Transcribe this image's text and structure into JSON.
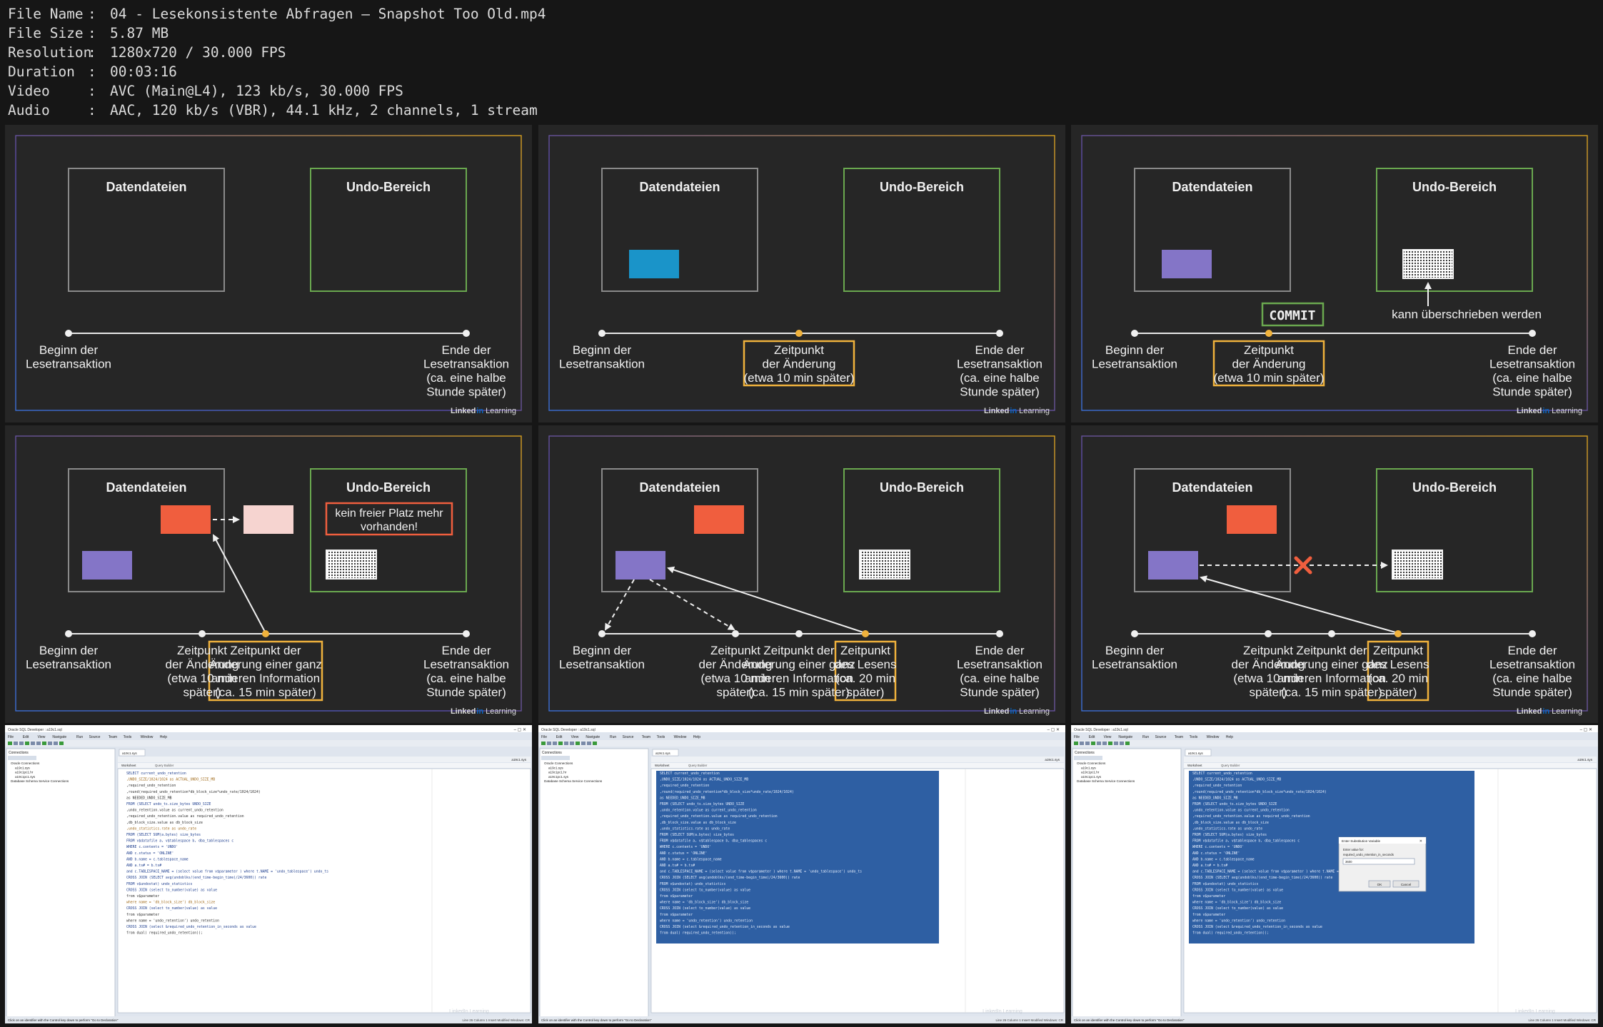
{
  "header": {
    "rows": [
      {
        "key": "File Name",
        "value": "04 - Lesekonsistente Abfragen – Snapshot Too Old.mp4"
      },
      {
        "key": "File Size",
        "value": "5.87 MB"
      },
      {
        "key": "Resolution",
        "value": "1280x720 / 30.000 FPS"
      },
      {
        "key": "Duration",
        "value": "00:03:16"
      },
      {
        "key": "Video",
        "value": "AVC (Main@L4), 123 kb/s, 30.000 FPS"
      },
      {
        "key": "Audio",
        "value": "AAC, 120 kb/s (VBR), 44.1 kHz, 2 channels, 1 stream"
      }
    ],
    "separator": ":"
  },
  "slides": {
    "datendateien": "Datendateien",
    "undo": "Undo-Bereich",
    "beginn": [
      "Beginn der",
      "Lesetransaktion"
    ],
    "ende": [
      "Ende der",
      "Lesetransaktion",
      "(ca. eine halbe",
      "Stunde später)"
    ],
    "aenderung": [
      "Zeitpunkt",
      "der Änderung",
      "(etwa 10 min später)"
    ],
    "aenderung_narrow": [
      "Zeitpunkt",
      "der Änderung",
      "(etwa 10 min",
      "später)"
    ],
    "andere": [
      "Zeitpunkt der",
      "Änderung einer ganz",
      "anderen Information",
      "(ca. 15 min später)"
    ],
    "lesen": [
      "Zeitpunkt",
      "des Lesens",
      "(ca. 20 min",
      "später)"
    ],
    "commit": "COMMIT",
    "ueberschrieben": "kann überschrieben werden",
    "kein_platz": [
      "kein freier Platz mehr",
      "vorhanden!"
    ],
    "brand_a": "Linked",
    "brand_in": "in",
    "brand_b": "Learning"
  },
  "ide": {
    "title": "Oracle SQL Developer : a19c1.sql",
    "menu": [
      "File",
      "Edit",
      "View",
      "Navigate",
      "Run",
      "Source",
      "Team",
      "Tools",
      "Window",
      "Help"
    ],
    "connections_label": "Connections",
    "tree": [
      "Oracle Connections",
      "a19c1.sys",
      "a19c1pc1.hr",
      "a19c1pc1.sys",
      "Database Schema Service Connections"
    ],
    "tab": "a19c1.sys",
    "subtabs": [
      "Worksheet",
      "Query Builder"
    ],
    "conn_label": "a19c1.sys",
    "code": [
      "SELECT current_undo_retention",
      "    ,UNDO_SIZE/1024/1024 as ACTUAL_UNDO_SIZE_MB",
      "    ,required_undo_retention",
      "    ,round(required_undo_retention*db_block_size*undo_rate/1024/1024)",
      "        as NEEDED_UNDO_SIZE_MB",
      "FROM (SELECT undo_ts.size_bytes UNDO_SIZE",
      "        ,undo_retention.value as current_undo_retention",
      "        ,required_undo_retention.value as required_undo_retention",
      "        ,db_block_size.value as db_block_size",
      "        ,undo_statistics.rate as undo_rate",
      "    FROM (SELECT SUM(a.bytes) size_bytes",
      "            FROM v$datafile a, v$tablespace b, dba_tablespaces c",
      "            WHERE c.contents = 'UNDO'",
      "            AND c.status = 'ONLINE'",
      "            AND b.name = c.tablespace_name",
      "            AND a.ts# = b.ts#",
      "            and c.TABLESPACE_NAME = (select value from v$parameter ) where t.NAME = 'undo_tablespace') undo_ts",
      "    CROSS JOIN (SELECT avg(undoblks/(end_time-begin_time)/24/3600)) rate",
      "                FROM v$undostat) undo_statistics",
      "    CROSS JOIN (select to_number(value) as value",
      "                from v$parameter",
      "                where name = 'db_block_size') db_block_size",
      "    CROSS JOIN (select to_number(value) as value",
      "                from v$parameter",
      "                where name = 'undo_retention') undo_retention",
      "    CROSS JOIN (select &required_undo_retention_in_seconds as value",
      "                from dual) required_undo_retention));"
    ],
    "status_text": "Click on an identifier with the Control key down to perform \"Go to Declaration\"",
    "status_right": [
      "Line 26 Column 1",
      "Insert",
      "Modified",
      "Windows: CR"
    ],
    "dialog": {
      "title": "Enter Substitution Variable",
      "label": "Enter value for:",
      "variable": "required_undo_retention_in_seconds",
      "value": "3600",
      "ok": "OK",
      "cancel": "Cancel"
    },
    "watermark": "LinkedIn Learning"
  },
  "colors": {
    "slide_bg": "#262626",
    "datendateien_border": "#8a8a8a",
    "undo_border": "#6aa84f",
    "highlight": "#f0b23c",
    "blue_block": "#1a94c9",
    "purple_block": "#8475c7",
    "red_block": "#f05e3e",
    "pink_block": "#f6d4d0",
    "sql_selection": "#2e5fa3",
    "ide_frame": "#dfe5ee"
  }
}
